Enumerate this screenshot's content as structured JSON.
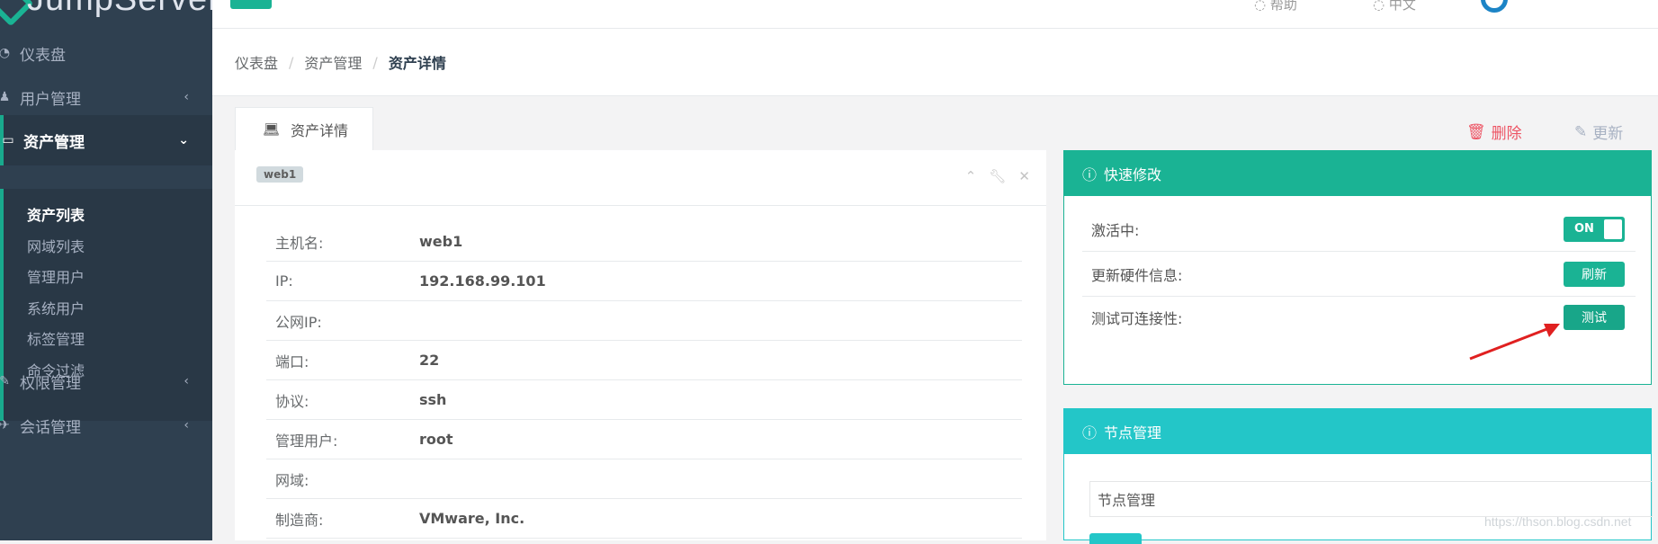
{
  "app": {
    "logo_text": "JumpServer"
  },
  "sidebar": {
    "items": [
      {
        "label": "仪表盘",
        "icon": "dashboard-icon"
      },
      {
        "label": "用户管理",
        "icon": "users-icon",
        "has_chevron": true
      },
      {
        "label": "资产管理",
        "icon": "inbox-icon",
        "expanded": true
      },
      {
        "label": "权限管理",
        "icon": "edit-icon",
        "has_chevron": true
      },
      {
        "label": "会话管理",
        "icon": "rocket-icon",
        "has_chevron": true
      }
    ],
    "submenu": [
      "资产列表",
      "网域列表",
      "管理用户",
      "系统用户",
      "标签管理",
      "命令过滤"
    ]
  },
  "topbar": {
    "item1": "帮助",
    "item2": "中文"
  },
  "breadcrumb": [
    "仪表盘",
    "资产管理",
    "资产详情"
  ],
  "tab": {
    "label": "资产详情"
  },
  "actions": {
    "delete_label": "删除",
    "update_label": "更新"
  },
  "asset": {
    "badge": "web1",
    "rows": [
      {
        "key": "主机名:",
        "value": "web1"
      },
      {
        "key": "IP:",
        "value": "192.168.99.101"
      },
      {
        "key": "公网IP:",
        "value": ""
      },
      {
        "key": "端口:",
        "value": "22"
      },
      {
        "key": "协议:",
        "value": "ssh"
      },
      {
        "key": "管理用户:",
        "value": "root"
      },
      {
        "key": "网域:",
        "value": ""
      },
      {
        "key": "制造商:",
        "value": "VMware, Inc."
      }
    ]
  },
  "quick_edit": {
    "title": "快速修改",
    "active_label": "激活中:",
    "toggle_label": "ON",
    "hardware_label": "更新硬件信息:",
    "refresh_button": "刷新",
    "test_label": "测试可连接性:",
    "test_button": "测试"
  },
  "node_manage": {
    "title": "节点管理",
    "input_value": "节点管理"
  },
  "watermark": "https://thson.blog.csdn.net",
  "colors": {
    "primary": "#1ab394",
    "info": "#23c6c8",
    "danger": "#ed5565",
    "sidebar": "#2f4050",
    "annotation_arrow": "#e02020"
  }
}
